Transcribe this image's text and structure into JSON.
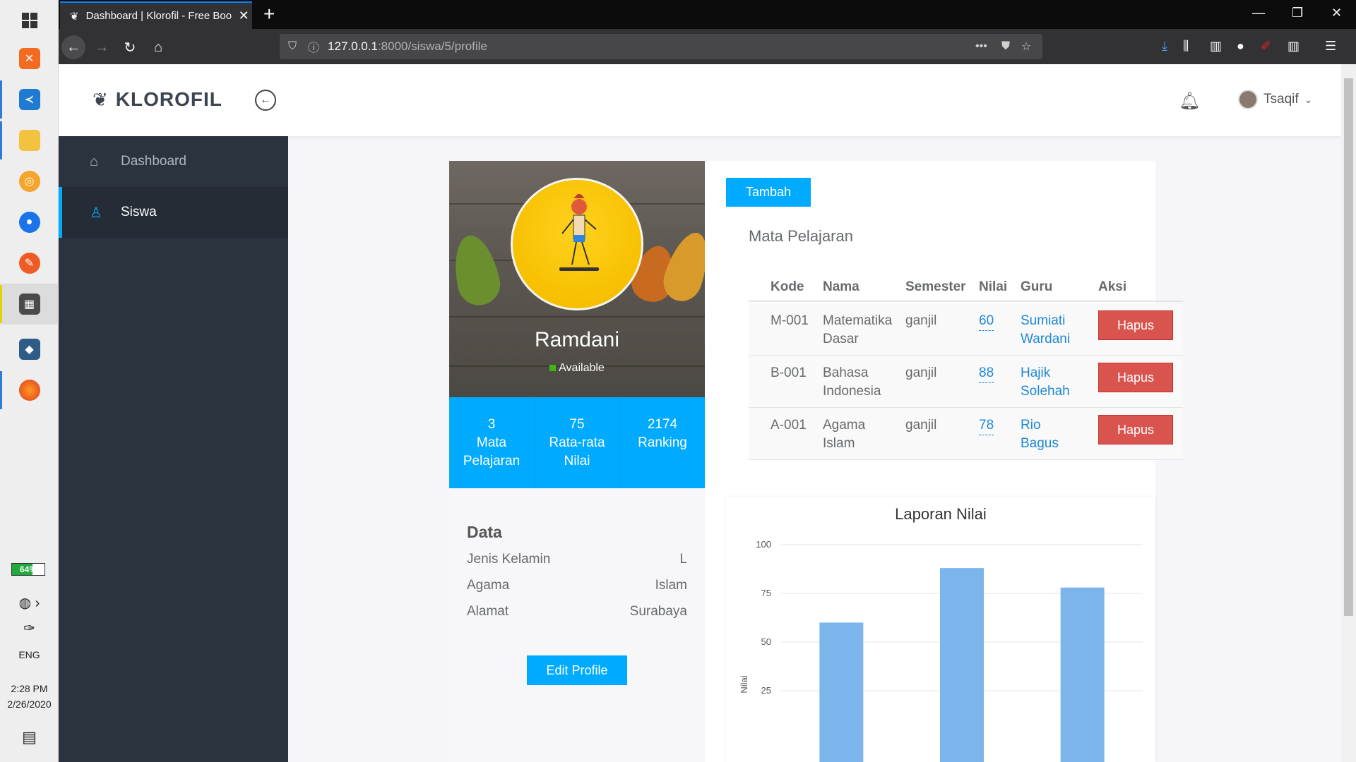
{
  "taskbar": {
    "battery": "64%",
    "language": "ENG",
    "time": "2:28 PM",
    "date": "2/26/2020",
    "apps": [
      "windows-start",
      "xampp",
      "vscode",
      "file-explorer",
      "chrome-canary",
      "maps",
      "postman",
      "media-player",
      "mysql-workbench",
      "firefox"
    ]
  },
  "browser": {
    "tab_title": "Dashboard | Klorofil - Free Boo",
    "url_host": "127.0.0.1",
    "url_path": ":8000/siswa/5/profile"
  },
  "app": {
    "brand": "KLOROFIL",
    "user": "Tsaqif",
    "sidebar": [
      {
        "label": "Dashboard",
        "icon": "home-icon"
      },
      {
        "label": "Siswa",
        "icon": "user-icon"
      }
    ]
  },
  "profile": {
    "name": "Ramdani",
    "status": "Available",
    "stats": [
      {
        "value": "3",
        "label": "Mata Pelajaran"
      },
      {
        "value": "75",
        "label": "Rata-rata Nilai"
      },
      {
        "value": "2174",
        "label": "Ranking"
      }
    ],
    "data_title": "Data",
    "data": [
      {
        "label": "Jenis Kelamin",
        "value": "L"
      },
      {
        "label": "Agama",
        "value": "Islam"
      },
      {
        "label": "Alamat",
        "value": "Surabaya"
      }
    ],
    "edit_label": "Edit Profile"
  },
  "subjects": {
    "add_label": "Tambah",
    "title": "Mata Pelajaran",
    "headers": [
      "Kode",
      "Nama",
      "Semester",
      "Nilai",
      "Guru",
      "Aksi"
    ],
    "rows": [
      {
        "kode": "M-001",
        "nama1": "Matematika",
        "nama2": "Dasar",
        "semester": "ganjil",
        "nilai": "60",
        "guru1": "Sumiati",
        "guru2": "Wardani",
        "aksi": "Hapus"
      },
      {
        "kode": "B-001",
        "nama1": "Bahasa",
        "nama2": "Indonesia",
        "semester": "ganjil",
        "nilai": "88",
        "guru1": "Hajik",
        "guru2": "Solehah",
        "aksi": "Hapus"
      },
      {
        "kode": "A-001",
        "nama1": "Agama",
        "nama2": "Islam",
        "semester": "ganjil",
        "nilai": "78",
        "guru1": "Rio",
        "guru2": "Bagus",
        "aksi": "Hapus"
      }
    ]
  },
  "chart_data": {
    "type": "bar",
    "title": "Laporan Nilai",
    "ylabel": "Nilai",
    "xlabel": "",
    "yticks": [
      25,
      50,
      75,
      100
    ],
    "ylim": [
      0,
      100
    ],
    "values": [
      60,
      88,
      78
    ],
    "color": "#7cb5ec",
    "grid": true
  }
}
